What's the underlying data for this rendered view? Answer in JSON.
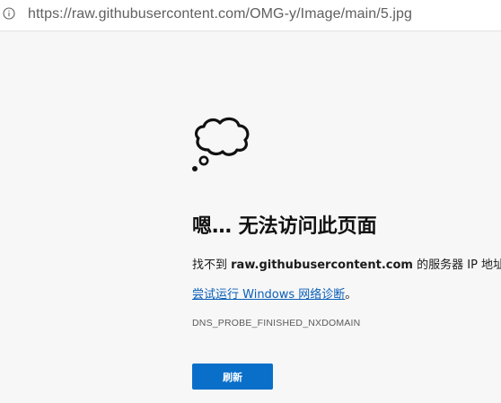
{
  "address_bar": {
    "url": "https://raw.githubusercontent.com/OMG-y/Image/main/5.jpg",
    "info_icon": "info-icon"
  },
  "error_page": {
    "illustration": "thought-cloud-icon",
    "title": "嗯… 无法访问此页面",
    "message_prefix": "找不到 ",
    "message_host": "raw.githubusercontent.com",
    "message_suffix": " 的服务器 IP 地址。",
    "diagnostics_link": "尝试运行 Windows 网络诊断",
    "diagnostics_suffix": "。",
    "error_code": "DNS_PROBE_FINISHED_NXDOMAIN",
    "reload_label": "刷新"
  },
  "colors": {
    "accent": "#0a6fc9",
    "link": "#0a5eb8",
    "background": "#f7f7f7"
  }
}
